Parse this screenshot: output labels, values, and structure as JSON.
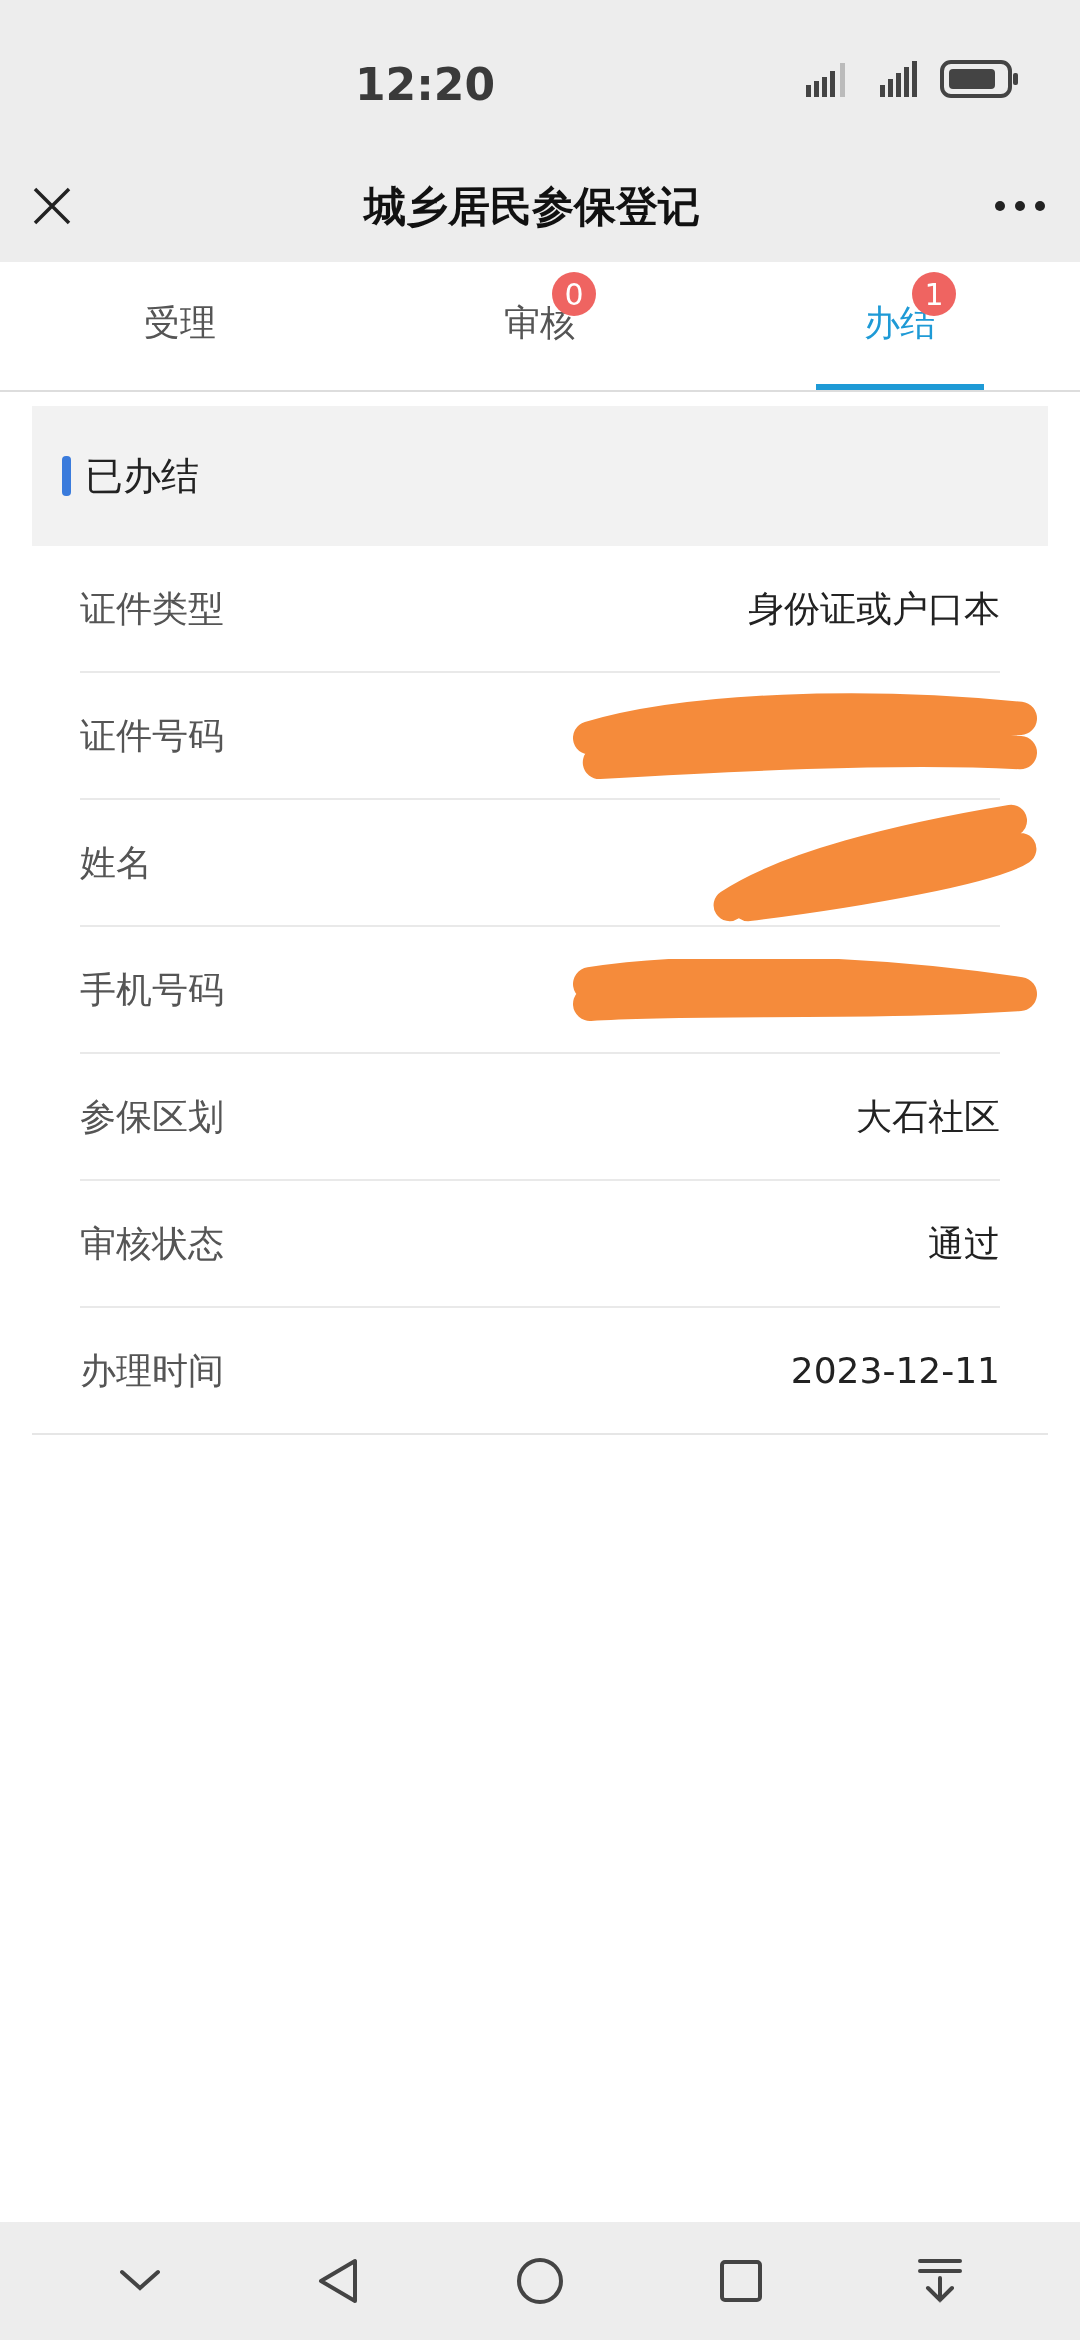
{
  "status_bar": {
    "time": "12:20"
  },
  "header": {
    "title": "城乡居民参保登记"
  },
  "tabs": [
    {
      "label": "受理",
      "selected": false
    },
    {
      "label": "审核",
      "selected": false,
      "badge": "0"
    },
    {
      "label": "办结",
      "selected": true,
      "badge": "1"
    }
  ],
  "section": {
    "title": "已办结"
  },
  "fields": [
    {
      "kind": "text",
      "label": "证件类型",
      "value": "身份证或户口本"
    },
    {
      "kind": "redacted",
      "label": "证件号码"
    },
    {
      "kind": "redacted",
      "label": "姓名"
    },
    {
      "kind": "redacted",
      "label": "手机号码"
    },
    {
      "kind": "text",
      "label": "参保区划",
      "value": "大石社区"
    },
    {
      "kind": "text",
      "label": "审核状态",
      "value": "通过"
    },
    {
      "kind": "text",
      "label": "办理时间",
      "value": "2023-12-11"
    }
  ]
}
